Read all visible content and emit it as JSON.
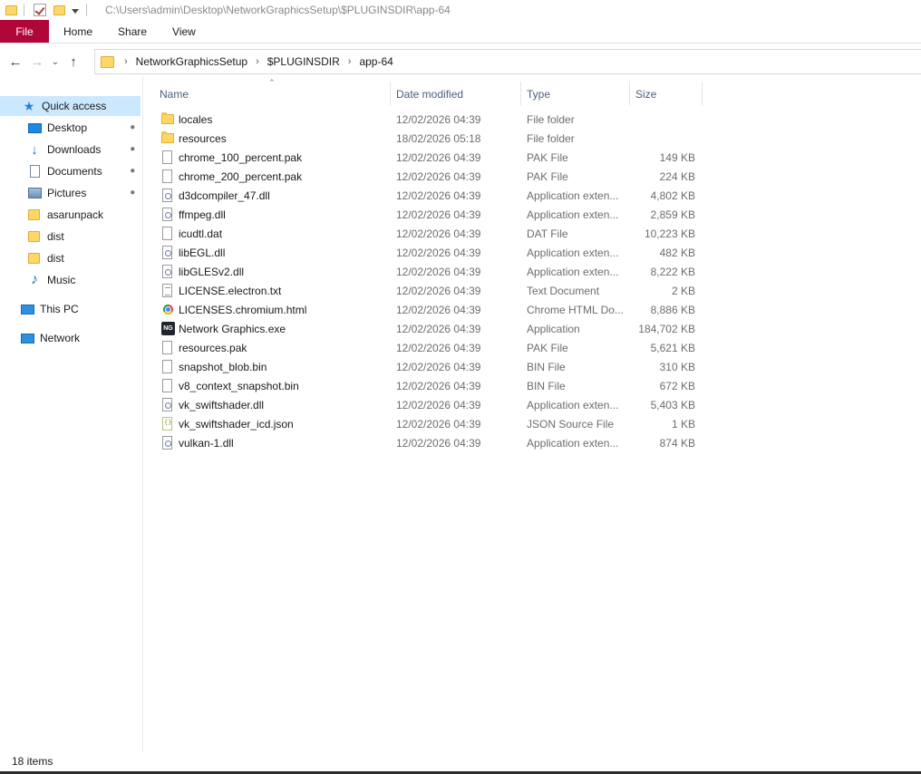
{
  "titlebar": {
    "path": "C:\\Users\\admin\\Desktop\\NetworkGraphicsSetup\\$PLUGINSDIR\\app-64"
  },
  "ribbon": {
    "file": "File",
    "tabs": [
      "Home",
      "Share",
      "View"
    ],
    "file_color": "#b1063a"
  },
  "address": {
    "crumbs": [
      "NetworkGraphicsSetup",
      "$PLUGINSDIR",
      "app-64"
    ]
  },
  "navpane": {
    "items": [
      {
        "label": "Quick access",
        "icon": "star-icon",
        "selected": true
      },
      {
        "label": "Desktop",
        "icon": "desktop-icon",
        "pinned": true
      },
      {
        "label": "Downloads",
        "icon": "download-arrow-icon",
        "pinned": true
      },
      {
        "label": "Documents",
        "icon": "documents-icon",
        "pinned": true
      },
      {
        "label": "Pictures",
        "icon": "pictures-icon",
        "pinned": true
      },
      {
        "label": "asarunpack",
        "icon": "folder-icon"
      },
      {
        "label": "dist",
        "icon": "folder-icon"
      },
      {
        "label": "dist",
        "icon": "folder-icon"
      },
      {
        "label": "Music",
        "icon": "music-note-icon"
      },
      {
        "label": "This PC",
        "icon": "computer-icon"
      },
      {
        "label": "Network",
        "icon": "network-icon"
      }
    ]
  },
  "columns": {
    "name": "Name",
    "date": "Date modified",
    "type": "Type",
    "size": "Size"
  },
  "files": [
    {
      "name": "locales",
      "date": "12/02/2026 04:39",
      "type": "File folder",
      "size": "",
      "icon": "folder"
    },
    {
      "name": "resources",
      "date": "18/02/2026 05:18",
      "type": "File folder",
      "size": "",
      "icon": "folder"
    },
    {
      "name": "chrome_100_percent.pak",
      "date": "12/02/2026 04:39",
      "type": "PAK File",
      "size": "149 KB",
      "icon": "doc"
    },
    {
      "name": "chrome_200_percent.pak",
      "date": "12/02/2026 04:39",
      "type": "PAK File",
      "size": "224 KB",
      "icon": "doc"
    },
    {
      "name": "d3dcompiler_47.dll",
      "date": "12/02/2026 04:39",
      "type": "Application exten...",
      "size": "4,802 KB",
      "icon": "dll"
    },
    {
      "name": "ffmpeg.dll",
      "date": "12/02/2026 04:39",
      "type": "Application exten...",
      "size": "2,859 KB",
      "icon": "dll"
    },
    {
      "name": "icudtl.dat",
      "date": "12/02/2026 04:39",
      "type": "DAT File",
      "size": "10,223 KB",
      "icon": "doc"
    },
    {
      "name": "libEGL.dll",
      "date": "12/02/2026 04:39",
      "type": "Application exten...",
      "size": "482 KB",
      "icon": "dll"
    },
    {
      "name": "libGLESv2.dll",
      "date": "12/02/2026 04:39",
      "type": "Application exten...",
      "size": "8,222 KB",
      "icon": "dll"
    },
    {
      "name": "LICENSE.electron.txt",
      "date": "12/02/2026 04:39",
      "type": "Text Document",
      "size": "2 KB",
      "icon": "txt"
    },
    {
      "name": "LICENSES.chromium.html",
      "date": "12/02/2026 04:39",
      "type": "Chrome HTML Do...",
      "size": "8,886 KB",
      "icon": "chrome"
    },
    {
      "name": "Network Graphics.exe",
      "date": "12/02/2026 04:39",
      "type": "Application",
      "size": "184,702 KB",
      "icon": "exe"
    },
    {
      "name": "resources.pak",
      "date": "12/02/2026 04:39",
      "type": "PAK File",
      "size": "5,621 KB",
      "icon": "doc"
    },
    {
      "name": "snapshot_blob.bin",
      "date": "12/02/2026 04:39",
      "type": "BIN File",
      "size": "310 KB",
      "icon": "doc"
    },
    {
      "name": "v8_context_snapshot.bin",
      "date": "12/02/2026 04:39",
      "type": "BIN File",
      "size": "672 KB",
      "icon": "doc"
    },
    {
      "name": "vk_swiftshader.dll",
      "date": "12/02/2026 04:39",
      "type": "Application exten...",
      "size": "5,403 KB",
      "icon": "dll"
    },
    {
      "name": "vk_swiftshader_icd.json",
      "date": "12/02/2026 04:39",
      "type": "JSON Source File",
      "size": "1 KB",
      "icon": "json"
    },
    {
      "name": "vulkan-1.dll",
      "date": "12/02/2026 04:39",
      "type": "Application exten...",
      "size": "874 KB",
      "icon": "dll"
    }
  ],
  "status": {
    "count": "18 items"
  }
}
